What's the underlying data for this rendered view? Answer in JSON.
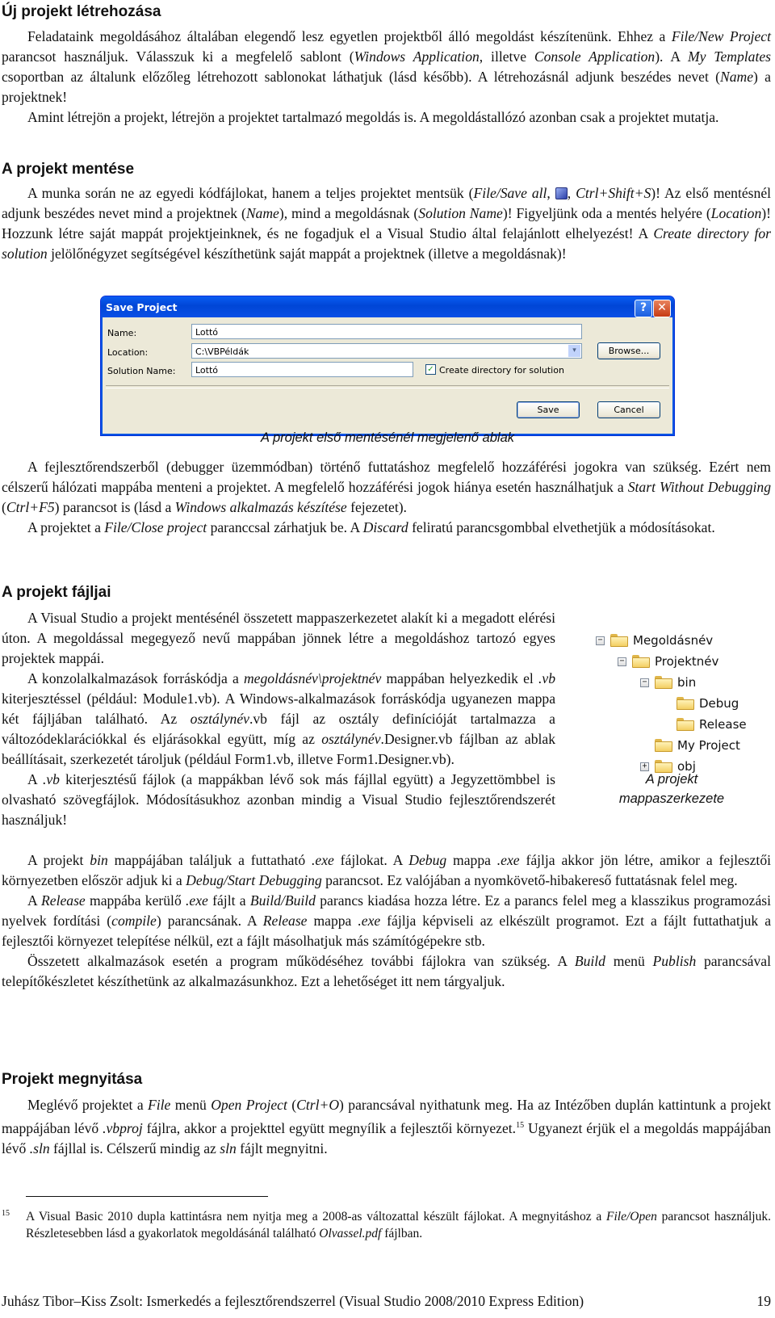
{
  "sections": {
    "new_project": {
      "heading": "Új projekt létrehozása",
      "p1": [
        "Feladataink megoldásához általában elegendő lesz egyetlen projektből álló megoldást készítenünk. Ehhez a ",
        "File/New Project",
        " parancsot használjuk. Válasszuk ki a megfelelő sablont (",
        "Windows Application",
        ", illetve ",
        "Console Application",
        "). A ",
        "My Templates",
        " csoportban az általunk előzőleg létrehozott sablonokat láthatjuk (lásd később). A létrehozásnál adjunk beszédes nevet (",
        "Name",
        ") a projektnek!"
      ],
      "p2": "Amint létrejön a projekt, létrejön a projektet tartalmazó megoldás is. A megoldástallózó azonban csak a projektet mutatja."
    },
    "save_project": {
      "heading": "A projekt mentése",
      "p1": [
        "A munka során ne az egyedi kódfájlokat, hanem a teljes projektet mentsük (",
        "File/Save all",
        ", ",
        ", ",
        "Ctrl+Shift+S",
        ")! Az első mentésnél adjunk beszédes nevet mind a projektnek (",
        "Name",
        "), mind a megoldásnak (",
        "Solution Name",
        ")! Figyeljünk oda a mentés helyére (",
        "Location",
        ")! Hozzunk létre saját mappát projektjeinknek, és ne fogadjuk el a Visual Studio által felajánlott elhelyezést! A ",
        "Create directory for solution",
        " jelölőnégyzet segítségével készíthetünk saját mappát a projektnek (illetve a megoldásnak)!"
      ],
      "save_all_icon": "save-all-icon",
      "caption": "A projekt első mentésénél megjelenő ablak",
      "p2": [
        "A fejlesztőrendszerből (debugger üzemmódban) történő futtatáshoz megfelelő hozzáférési jogokra van szükség. Ezért nem célszerű hálózati mappába menteni a projektet. A megfelelő hozzáférési jogok hiánya esetén használhatjuk a ",
        "Start Without Debugging",
        " (",
        "Ctrl+F5",
        ") parancsot is (lásd a ",
        "Windows alkalmazás készítése",
        " fejezetet)."
      ],
      "p3": [
        "A projektet a ",
        "File/Close project",
        " paranccsal zárhatjuk be. A ",
        "Discard",
        " feliratú parancsgombbal elvethetjük a módosításokat."
      ]
    },
    "project_files": {
      "heading": "A projekt fájljai",
      "p1": "A Visual Studio a projekt mentésénél összetett mappaszerkezetet alakít ki a megadott elérési úton. A megoldással megegyező nevű mappában jönnek létre a megoldáshoz tartozó egyes projektek mappái.",
      "p2": [
        "A konzolalkalmazások forráskódja a ",
        "megoldásnév\\projektnév",
        " mappában helyezkedik el ",
        ".vb",
        " kiterjesztéssel (például: Module1.vb). A Windows-alkalmazások forráskódja ugyanezen mappa két fájljában található. Az ",
        "osztálynév",
        ".vb fájl az osztály definícióját tartalmazza a változódeklarációkkal és eljárásokkal együtt, míg az ",
        "osztálynév",
        ".Designer.vb fájlban az ablak beállításait, szerkezetét tároljuk (például Form1.vb, illetve Form1.Designer.vb)."
      ],
      "p3": [
        "A ",
        ".vb",
        " kiterjesztésű fájlok (a mappákban lévő sok más fájllal együtt) a Jegyzettömbbel is olvasható szövegfájlok. Módosításukhoz azonban mindig a Visual Studio fejlesztőrendszerét használjuk!"
      ],
      "p4": [
        "A projekt ",
        "bin",
        " mappájában találjuk a futtatható ",
        ".exe",
        " fájlokat. A ",
        "Debug",
        " mappa ",
        ".exe",
        " fájlja akkor jön létre, amikor a fejlesztői környezetben először adjuk ki a ",
        "Debug/Start Debugging",
        " parancsot. Ez valójában a nyomkövető-hibakereső futtatásnak felel meg."
      ],
      "p5": [
        "A ",
        "Release",
        " mappába kerülő ",
        ".exe",
        " fájlt a ",
        "Build/Build",
        " parancs kiadása hozza létre. Ez a parancs felel meg a klasszikus programozási nyelvek fordítási (",
        "compile",
        ") parancsának. A ",
        "Release",
        " mappa ",
        ".exe",
        " fájlja képviseli az elkészült programot. Ezt a fájlt futtathatjuk a fejlesztői környezet telepítése nélkül, ezt a fájlt másolhatjuk más számítógépekre stb."
      ],
      "p6": [
        "Összetett alkalmazások esetén a program működéséhez további fájlokra van szükség. A ",
        "Build",
        " menü ",
        "Publish",
        " parancsával telepítőkészletet készíthetünk az alkalmazásunkhoz. Ezt a lehetőséget itt nem tárgyaljuk."
      ],
      "tree": {
        "caption_line1": "A projekt",
        "caption_line2": "mappaszerkezete",
        "nodes": [
          {
            "label": "Megoldásnév",
            "toggle": "−",
            "depth": 0
          },
          {
            "label": "Projektnév",
            "toggle": "−",
            "depth": 1
          },
          {
            "label": "bin",
            "toggle": "−",
            "depth": 2
          },
          {
            "label": "Debug",
            "toggle": "",
            "depth": 3
          },
          {
            "label": "Release",
            "toggle": "",
            "depth": 3
          },
          {
            "label": "My Project",
            "toggle": "",
            "depth": 2
          },
          {
            "label": "obj",
            "toggle": "+",
            "depth": 2
          }
        ]
      }
    },
    "open_project": {
      "heading": "Projekt megnyitása",
      "p1": [
        "Meglévő projektet a ",
        "File",
        " menü ",
        "Open Project",
        " (",
        "Ctrl+O",
        ") parancsával nyithatunk meg. Ha az Intézőben duplán kattintunk a projekt mappájában lévő ",
        ".vbproj",
        " fájlra, akkor a projekttel együtt megnyílik a fejlesztői környezet.",
        "15",
        " Ugyanezt érjük el a megoldás mappájában lévő ",
        ".sln",
        " fájllal is. Célszerű mindig az ",
        "sln",
        " fájlt megnyitni."
      ]
    }
  },
  "dialog": {
    "title": "Save Project",
    "help_button": "?",
    "close_button": "✕",
    "name_label": "Name:",
    "name_value": "Lottó",
    "location_label": "Location:",
    "location_value": "C:\\VBPéldák",
    "location_arrow": "▾",
    "solution_label": "Solution Name:",
    "solution_value": "Lottó",
    "create_dir_label": "Create directory for solution",
    "create_dir_checked": "✓",
    "browse_button": "Browse...",
    "save_button": "Save",
    "cancel_button": "Cancel"
  },
  "footnote": {
    "number": "15",
    "text": [
      "A Visual Basic 2010 dupla kattintásra nem nyitja meg a 2008-as változattal készült fájlokat. A megnyitáshoz a ",
      "File/Open",
      " parancsot használjuk. Részletesebben lásd a gyakorlatok megoldásánál található ",
      "Olvassel.pdf",
      " fájlban."
    ]
  },
  "footer": {
    "text": "Juhász Tibor–Kiss Zsolt: Ismerkedés a fejlesztőrendszerrel (Visual Studio 2008/2010 Express Edition)",
    "page_number": "19"
  }
}
